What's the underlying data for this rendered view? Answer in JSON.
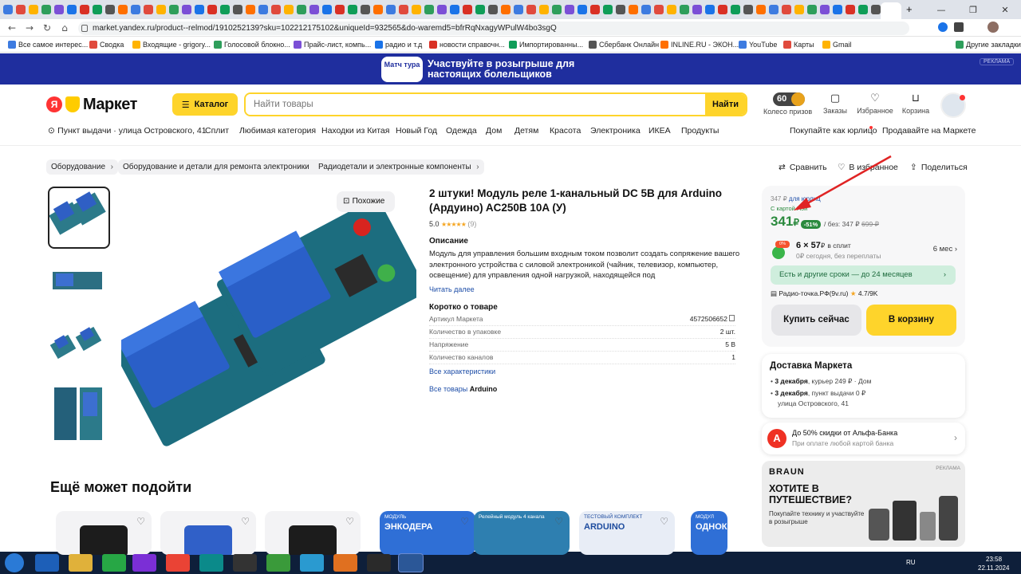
{
  "browser": {
    "url": "market.yandex.ru/product--relmod/1910252139?sku=102212175102&uniqueId=932565&do-waremd5=bfrRqNxagyWPulW4bo3sgQ",
    "new_tab": "+",
    "minimize": "—",
    "maximize": "❐",
    "close": "✕"
  },
  "bookmarks": [
    "Все самое интерес...",
    "Сводка",
    "Входящие - grigory...",
    "Голосовой блокно...",
    "Прайс-лист, компь...",
    "радио и т.д",
    "новости справочн...",
    "Импортированны...",
    "Сбербанк Онлайн",
    "INLINE.RU - ЭКОН...",
    "YouTube",
    "Карты",
    "Gmail",
    "Другие закладки"
  ],
  "banner": {
    "logo": "Матч тура",
    "text": "Участвуйте в розыгрыше для настоящих болельщиков",
    "tag": "РЕКЛАМА"
  },
  "header": {
    "logo": "Маркет",
    "logo_ya": "Я",
    "catalog": "Каталог",
    "search_placeholder": "Найти товары",
    "search_button": "Найти",
    "coins": "60",
    "wheel": "Колесо призов",
    "orders": "Заказы",
    "favorites": "Избранное",
    "cart": "Корзина"
  },
  "nav": {
    "pickup": "Пункт выдачи · улица Островского, 41",
    "items": [
      "Сплит",
      "Любимая категория",
      "Находки из Китая",
      "Новый Год",
      "Одежда",
      "Дом",
      "Детям",
      "Красота",
      "Электроника",
      "ИКЕА",
      "Продукты"
    ],
    "legal": "Покупайте как юрлицо",
    "sell": "Продавайте на Маркете"
  },
  "breadcrumbs": [
    "Оборудование",
    "Оборудование и детали для ремонта электроники",
    "Радиодетали и электронные компоненты"
  ],
  "actions": {
    "compare": "Сравнить",
    "favorite": "В избранное",
    "share": "Поделиться"
  },
  "gallery": {
    "similar": "Похожие"
  },
  "product": {
    "title": "2 штуки! Модуль реле 1-канальный DC 5В для Arduino (Ардуино) AC250B 10A (У)",
    "rating": "5.0",
    "stars": "★★★★★",
    "reviews": "(9)",
    "desc_title": "Описание",
    "description": "Модуль для управления большим входным током позволит создать сопряжение вашего электронного устройства с силовой электроникой (чайник, телевизор, компьютер, освещение) для управления одной нагрузкой, находящейся под",
    "read_more": "Читать далее",
    "about_title": "Коротко о товаре",
    "specs": [
      {
        "k": "Артикул Маркета",
        "v": "4572506652"
      },
      {
        "k": "Количество в упаковке",
        "v": "2 шт."
      },
      {
        "k": "Напряжение",
        "v": "5 В"
      },
      {
        "k": "Количество каналов",
        "v": "1"
      }
    ],
    "all_specs": "Все характеристики",
    "all_goods_prefix": "Все товары",
    "brand": "Arduino"
  },
  "price": {
    "old": "347 ₽",
    "legal": "для юрлиц",
    "card_pay": "С картой Пэй",
    "current": "341",
    "currency": "₽",
    "discount": "-51%",
    "without": "/ без: 347 ₽",
    "crossed": "699 ₽",
    "split_badge": "0%",
    "split_amount": "6 × 57",
    "split_currency": "₽",
    "split_label": "в сплит",
    "split_note": "0₽ сегодня, без переплаты",
    "split_term": "6 мес ›",
    "other_terms": "Есть и другие сроки — до 24 месяцев",
    "seller": "Радио-точка.РФ(9v.ru)",
    "seller_rating": "4.7/9K",
    "buy_now": "Купить сейчас",
    "to_cart": "В корзину"
  },
  "delivery": {
    "title": "Доставка Маркета",
    "rows": [
      {
        "date": "3 декабря",
        "rest": ", курьер  249 ₽ · Дом"
      },
      {
        "date": "3 декабря",
        "rest": ", пункт выдачи  0 ₽"
      }
    ],
    "address": "улица Островского, 41"
  },
  "alfa": {
    "letter": "А",
    "title": "До 50% скидки от Альфа-Банка",
    "subtitle": "При оплате любой картой банка"
  },
  "ad": {
    "brand": "BRAUN",
    "headline": "ХОТИТЕ В ПУТЕШЕСТВИЕ?",
    "sub": "Покупайте технику и участвуйте в розыгрыше",
    "tag": "РЕКЛАМА"
  },
  "more_title": "Ещё может подойти",
  "rec_cards": [
    {
      "label": "",
      "big": ""
    },
    {
      "label": "",
      "big": ""
    },
    {
      "label": "",
      "big": ""
    },
    {
      "label": "МОДУЛЬ",
      "big": "ЭНКОДЕРА"
    },
    {
      "label": "Релейный модуль 4 канала",
      "big": ""
    },
    {
      "label": "ТЕСТОВЫЙ КОМПЛЕКТ",
      "big": "ARDUINO"
    },
    {
      "label": "МОДУЛ",
      "big": "ОДНОКА"
    }
  ],
  "tray": {
    "lang": "RU",
    "time": "23:58",
    "date": "22.11.2024"
  },
  "colors": {
    "yellow": "#fed42b",
    "green": "#2b8a3e",
    "banner": "#1f2e9e",
    "taskbar": "#0e1f3a"
  }
}
